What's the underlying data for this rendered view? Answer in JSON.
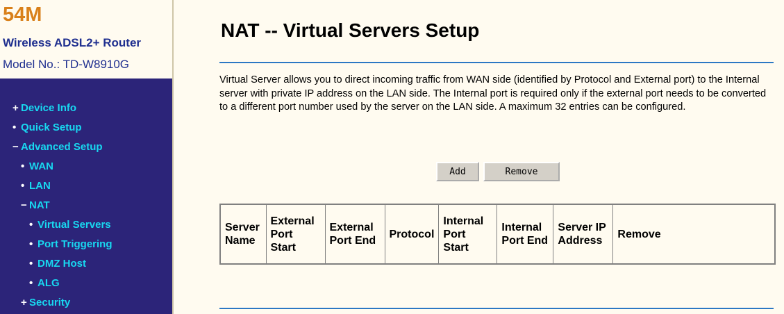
{
  "brand": {
    "speed": "54M",
    "product": "Wireless ADSL2+ Router",
    "model_label": "Model No.: ",
    "model_value": "TD-W8910G"
  },
  "nav": [
    {
      "mark": "+",
      "label": "Device Info"
    },
    {
      "mark": "•",
      "label": "Quick Setup"
    },
    {
      "mark": "−",
      "label": "Advanced Setup"
    },
    {
      "mark": "•",
      "label": "WAN"
    },
    {
      "mark": "•",
      "label": "LAN"
    },
    {
      "mark": "−",
      "label": "NAT"
    },
    {
      "mark": "•",
      "label": "Virtual Servers"
    },
    {
      "mark": "•",
      "label": "Port Triggering"
    },
    {
      "mark": "•",
      "label": "DMZ Host"
    },
    {
      "mark": "•",
      "label": "ALG"
    },
    {
      "mark": "+",
      "label": "Security"
    }
  ],
  "page": {
    "title": "NAT -- Virtual Servers Setup",
    "description": "Virtual Server allows you to direct incoming traffic from WAN side (identified by Protocol and External port) to the Internal server with private IP address on the LAN side. The Internal port is required only if the external port needs to be converted to a different port number used by the server on the LAN side. A maximum 32 entries can be configured."
  },
  "buttons": {
    "add": "Add",
    "remove": "Remove"
  },
  "table": {
    "headers": [
      "Server Name",
      "External Port Start",
      "External Port End",
      "Protocol",
      "Internal Port Start",
      "Internal Port End",
      "Server IP Address",
      "Remove"
    ]
  },
  "colors": {
    "nav_background": "#2c2479",
    "nav_link": "#18d8f0",
    "brand_orange": "#d9801a",
    "brand_blue": "#1f2f8f",
    "rule_blue": "#2c78c4",
    "page_background": "#fffbf0"
  }
}
